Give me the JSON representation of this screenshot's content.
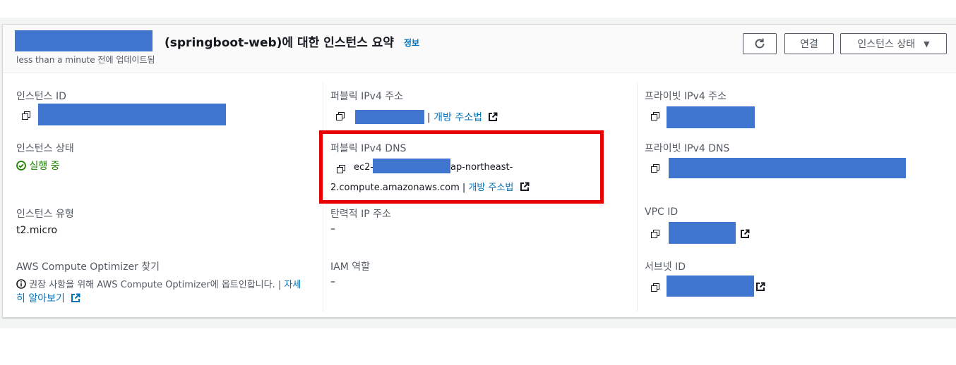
{
  "header": {
    "title": "(springboot-web)에 대한 인스턴스 요약",
    "info_link": "정보",
    "subtitle": "less than a minute 전에 업데이트됨",
    "buttons": {
      "connect": "연결",
      "instance_state": "인스턴스 상태"
    }
  },
  "col1": {
    "instance_id_label": "인스턴스 ID",
    "instance_state_label": "인스턴스 상태",
    "instance_state_value": "실행 중",
    "instance_type_label": "인스턴스 유형",
    "instance_type_value": "t2.micro",
    "optimizer_label": "AWS Compute Optimizer 찾기",
    "optimizer_text_1": "권장 사항을 위해 AWS Compute Optimizer에 옵트인합니다. |",
    "optimizer_link_1": "자세",
    "optimizer_link_2": "히 알아보기"
  },
  "col2": {
    "public_ipv4_label": "퍼블릭 IPv4 주소",
    "sep": "|",
    "open_address_link": "개방 주소법",
    "public_dns_label": "퍼블릭 IPv4 DNS",
    "public_dns_prefix": "ec2-",
    "public_dns_suffix": "ap-northeast-",
    "public_dns_line2": "2.compute.amazonaws.com",
    "elastic_ip_label": "탄력적 IP 주소",
    "elastic_ip_value": "–",
    "iam_role_label": "IAM 역할",
    "iam_role_value": "–"
  },
  "col3": {
    "private_ipv4_label": "프라이빗 IPv4 주소",
    "private_dns_label": "프라이빗 IPv4 DNS",
    "vpc_id_label": "VPC ID",
    "subnet_id_label": "서브넷 ID"
  },
  "colors": {
    "link": "#0073bb",
    "success": "#1d8102",
    "redaction": "#3f75ce",
    "highlight_box": "#e80000"
  },
  "icons": [
    "refresh-icon",
    "caret-down-icon",
    "copy-icon",
    "external-link-icon",
    "status-ok-icon",
    "info-icon"
  ]
}
